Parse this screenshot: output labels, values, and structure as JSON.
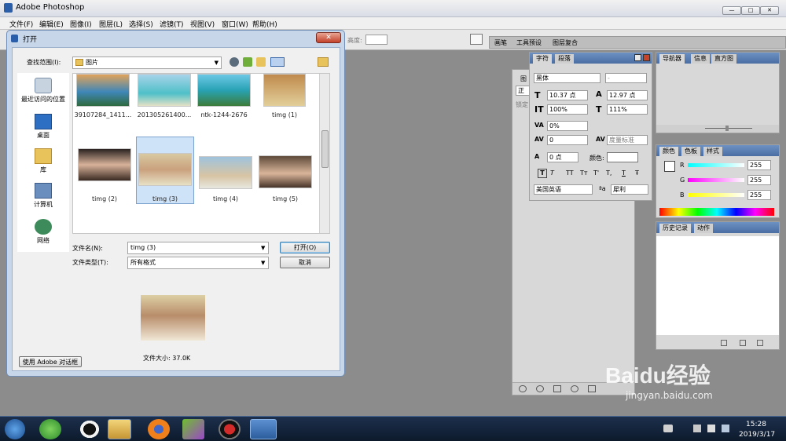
{
  "app": {
    "title": "Adobe Photoshop",
    "window_buttons": [
      "—",
      "□",
      "✕"
    ],
    "menu": [
      "文件(F)",
      "编辑(E)",
      "图像(I)",
      "图层(L)",
      "选择(S)",
      "滤镜(T)",
      "视图(V)",
      "窗口(W)",
      "帮助(H)"
    ]
  },
  "options_bar": {
    "height_label": "高度:",
    "tabs": [
      "画笔",
      "工具预设",
      "图层复合"
    ]
  },
  "dialog": {
    "title": "打开",
    "close": "✕",
    "look_in_label": "查找范围(I):",
    "look_in_value": "图片",
    "places": [
      "最近访问的位置",
      "桌面",
      "库",
      "计算机",
      "网络"
    ],
    "files_row1": [
      "39107284_1411...",
      "201305261400...",
      "ntk-1244-2676",
      "timg (1)"
    ],
    "files_row2": [
      "timg (2)",
      "timg (3)",
      "timg (4)",
      "timg (5)"
    ],
    "filename_label": "文件名(N):",
    "filename_value": "timg (3)",
    "filetype_label": "文件类型(T):",
    "filetype_value": "所有格式",
    "open_button": "打开(O)",
    "cancel_button": "取消",
    "file_size": "文件大小: 37.0K",
    "adobe_dialog_button": "使用 Adobe 对话框"
  },
  "layers_panel": {
    "tab": "图",
    "mode": "正",
    "lock": "锁定"
  },
  "char_panel": {
    "tabs": [
      "字符",
      "段落"
    ],
    "font": "黑体",
    "style": "-",
    "size": "10.37 点",
    "leading": "12.97 点",
    "vscale": "100%",
    "hscale": "111%",
    "tracking": "0%",
    "kerning": "0",
    "kern_mode": "度量标准",
    "baseline": "0 点",
    "color_label": "颜色:",
    "style_buttons": [
      "T",
      "T",
      "TT",
      "Tт",
      "T'",
      "T,",
      "T",
      "Ŧ"
    ],
    "language": "美国英语",
    "aa_icon": "ªa",
    "aa_value": "犀利"
  },
  "nav_panel": {
    "tabs": [
      "导航器",
      "信息",
      "直方图"
    ]
  },
  "color_panel": {
    "tabs": [
      "颜色",
      "色板",
      "样式"
    ],
    "channels": [
      {
        "label": "R",
        "value": "255"
      },
      {
        "label": "G",
        "value": "255"
      },
      {
        "label": "B",
        "value": "255"
      }
    ]
  },
  "history_panel": {
    "tabs": [
      "历史记录",
      "动作"
    ]
  },
  "watermark": {
    "text": "Baidu经验",
    "url": "jingyan.baidu.com"
  },
  "taskbar": {
    "time": "15:28",
    "date": "2019/3/17",
    "icons": [
      "start-orb",
      "360-icon",
      "qq-icon",
      "folder-icon",
      "firefox-icon",
      "media-icon",
      "record-icon",
      "photoshop-icon"
    ]
  }
}
